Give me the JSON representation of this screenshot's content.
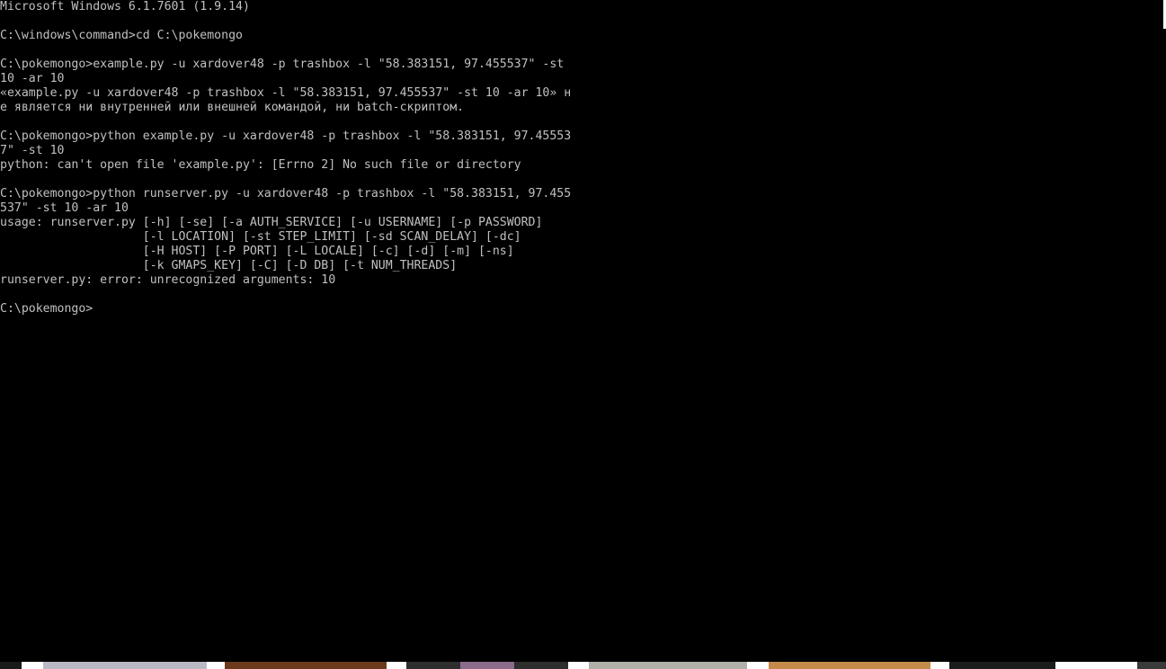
{
  "console": {
    "lines": [
      "Microsoft Windows 6.1.7601 (1.9.14)",
      "",
      "C:\\windows\\command>cd C:\\pokemongo",
      "",
      "C:\\pokemongo>example.py -u xardover48 -p trashbox -l \"58.383151, 97.455537\" -st",
      "10 -ar 10",
      "«example.py -u xardover48 -p trashbox -l \"58.383151, 97.455537\" -st 10 -ar 10» н",
      "е является ни внутренней или внешней командой, ни batch-скриптом.",
      "",
      "C:\\pokemongo>python example.py -u xardover48 -p trashbox -l \"58.383151, 97.45553",
      "7\" -st 10",
      "python: can't open file 'example.py': [Errno 2] No such file or directory",
      "",
      "C:\\pokemongo>python runserver.py -u xardover48 -p trashbox -l \"58.383151, 97.455",
      "537\" -st 10 -ar 10",
      "usage: runserver.py [-h] [-se] [-a AUTH_SERVICE] [-u USERNAME] [-p PASSWORD]",
      "                    [-l LOCATION] [-st STEP_LIMIT] [-sd SCAN_DELAY] [-dc]",
      "                    [-H HOST] [-P PORT] [-L LOCALE] [-c] [-d] [-m] [-ns]",
      "                    [-k GMAPS_KEY] [-C] [-D DB] [-t NUM_THREADS]",
      "runserver.py: error: unrecognized arguments: 10",
      "",
      "C:\\pokemongo>"
    ]
  },
  "colors": {
    "console_background": "#000000",
    "console_text": "#c0c0c0",
    "thumbnail_tints": [
      "#1a1a1a",
      "#b9b9c6",
      "#6b3a1c",
      "#2e2e2e",
      "#8a6b8c",
      "#b0b0a8",
      "#c48a4a",
      "#1c1c1c",
      "#3a3a3a"
    ]
  }
}
